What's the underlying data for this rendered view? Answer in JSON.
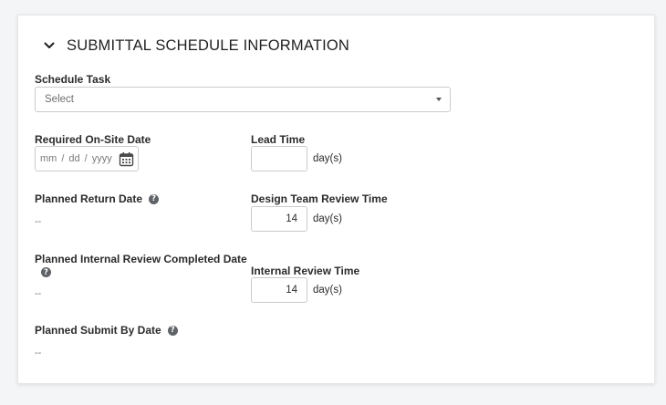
{
  "section": {
    "title": "SUBMITTAL SCHEDULE INFORMATION",
    "toggle_icon": "chevron-down-icon"
  },
  "schedule_task": {
    "label": "Schedule Task",
    "placeholder": "Select"
  },
  "required_on_site_date": {
    "label": "Required On-Site Date",
    "mm": "mm",
    "dd": "dd",
    "yyyy": "yyyy",
    "separator": "/",
    "icon": "calendar-icon"
  },
  "lead_time": {
    "label": "Lead Time",
    "value": "",
    "unit": "day(s)"
  },
  "planned_return_date": {
    "label": "Planned Return Date",
    "value": "--"
  },
  "design_team_review_time": {
    "label": "Design Team Review Time",
    "value": "14",
    "unit": "day(s)"
  },
  "planned_internal_review_completed_date": {
    "label": "Planned Internal Review Completed Date",
    "value": "--"
  },
  "internal_review_time": {
    "label": "Internal Review Time",
    "value": "14",
    "unit": "day(s)"
  },
  "planned_submit_by_date": {
    "label": "Planned Submit By Date",
    "value": "--"
  },
  "help_glyph": "?"
}
